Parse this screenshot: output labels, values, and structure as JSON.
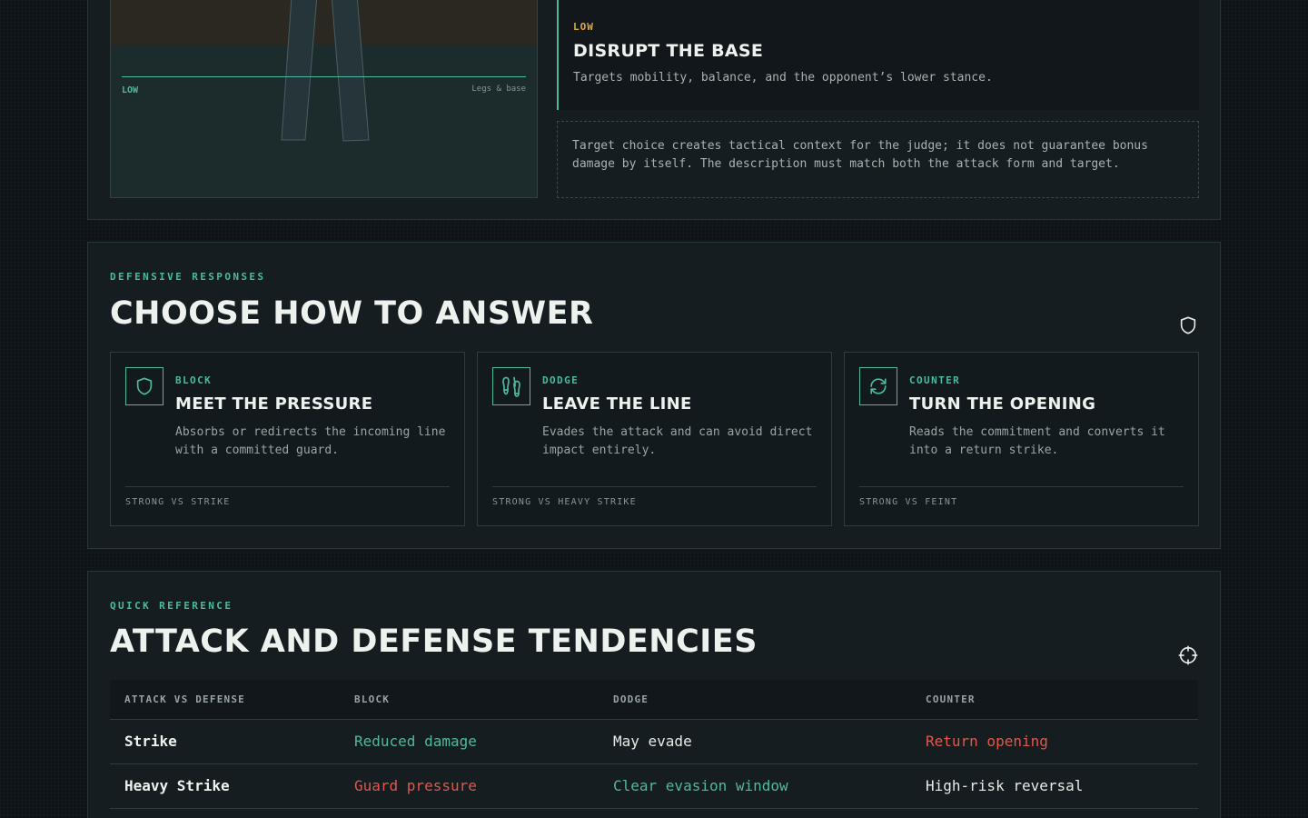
{
  "target_section": {
    "diagram": {
      "zone_label": "LOW",
      "zone_desc": "Legs & base"
    },
    "zone_card": {
      "kicker": "LOW",
      "title": "DISRUPT THE BASE",
      "description": "Targets mobility, balance, and the opponent’s lower stance."
    },
    "note": "Target choice creates tactical context for the judge; it does not guarantee bonus damage by itself. The description must match both the attack form and target."
  },
  "defensive": {
    "eyebrow": "DEFENSIVE RESPONSES",
    "title": "CHOOSE HOW TO ANSWER",
    "icon": "shield-icon",
    "cards": [
      {
        "icon": "shield-icon",
        "kicker": "BLOCK",
        "title": "MEET THE PRESSURE",
        "description": "Absorbs or redirects the incoming line with a committed guard.",
        "footer": "STRONG VS STRIKE"
      },
      {
        "icon": "footprints-icon",
        "kicker": "DODGE",
        "title": "LEAVE THE LINE",
        "description": "Evades the attack and can avoid direct impact entirely.",
        "footer": "STRONG VS HEAVY STRIKE"
      },
      {
        "icon": "refresh-icon",
        "kicker": "COUNTER",
        "title": "TURN THE OPENING",
        "description": "Reads the commitment and converts it into a return strike.",
        "footer": "STRONG VS FEINT"
      }
    ]
  },
  "reference": {
    "eyebrow": "QUICK REFERENCE",
    "title": "ATTACK AND DEFENSE TENDENCIES",
    "icon": "crosshair-icon",
    "columns": [
      "ATTACK VS DEFENSE",
      "BLOCK",
      "DODGE",
      "COUNTER"
    ],
    "rows": [
      {
        "attack": "Strike",
        "block": "Reduced damage",
        "dodge": "May evade",
        "counter": "Return opening"
      },
      {
        "attack": "Heavy Strike",
        "block": "Guard pressure",
        "dodge": "Clear evasion window",
        "counter": "High-risk reversal"
      }
    ],
    "colors": {
      "good": "#4fb8a0",
      "bad": "#e0584a",
      "neutral": "#e6ebe8"
    }
  }
}
